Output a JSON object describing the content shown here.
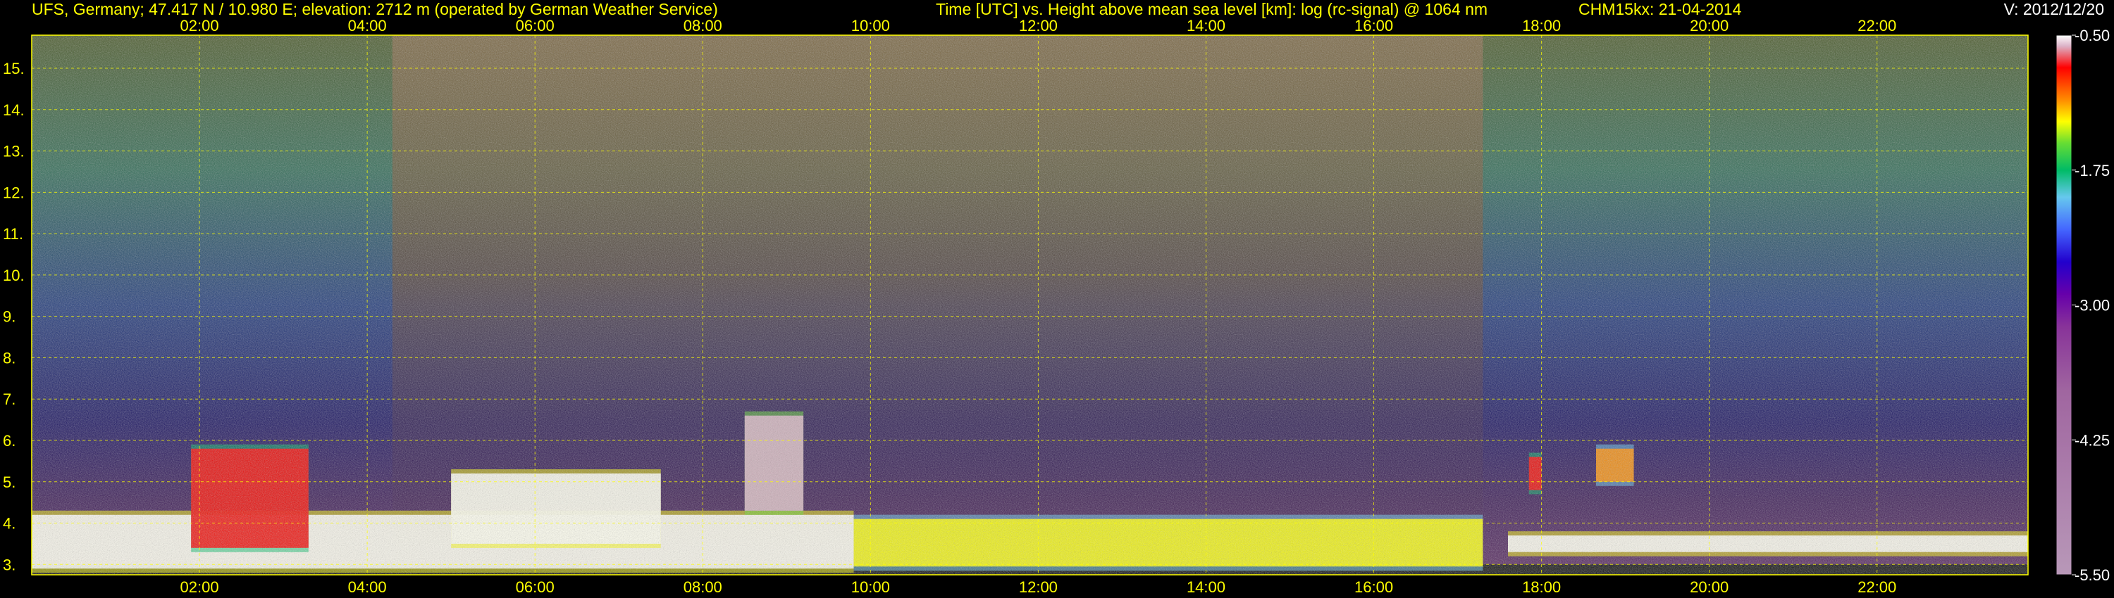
{
  "header": {
    "station": "UFS, Germany; 47.417 N / 10.980 E; elevation: 2712 m  (operated by German Weather Service)",
    "axes": "Time [UTC] vs. Height above mean sea level [km]: log (rc-signal) @ 1064 nm",
    "instrument": "CHM15kx: 21-04-2014",
    "version": "V: 2012/12/20"
  },
  "chart_data": {
    "type": "heatmap",
    "title": "Time [UTC] vs. Height above mean sea level [km]: log (rc-signal) @ 1064 nm",
    "x_unit": "hours UTC",
    "xlim": [
      0.0,
      23.8
    ],
    "x_ticks": [
      {
        "value": 2,
        "label": "02:00"
      },
      {
        "value": 4,
        "label": "04:00"
      },
      {
        "value": 6,
        "label": "06:00"
      },
      {
        "value": 8,
        "label": "08:00"
      },
      {
        "value": 10,
        "label": "10:00"
      },
      {
        "value": 12,
        "label": "12:00"
      },
      {
        "value": 14,
        "label": "14:00"
      },
      {
        "value": 16,
        "label": "16:00"
      },
      {
        "value": 18,
        "label": "18:00"
      },
      {
        "value": 20,
        "label": "20:00"
      },
      {
        "value": 22,
        "label": "22:00"
      }
    ],
    "y_unit": "km",
    "ylim": [
      2.75,
      15.8
    ],
    "y_ticks": [
      {
        "value": 3,
        "label": "3."
      },
      {
        "value": 4,
        "label": "4."
      },
      {
        "value": 5,
        "label": "5."
      },
      {
        "value": 6,
        "label": "6."
      },
      {
        "value": 7,
        "label": "7."
      },
      {
        "value": 8,
        "label": "8."
      },
      {
        "value": 9,
        "label": "9."
      },
      {
        "value": 10,
        "label": "10."
      },
      {
        "value": 11,
        "label": "11."
      },
      {
        "value": 12,
        "label": "12."
      },
      {
        "value": 13,
        "label": "13."
      },
      {
        "value": 14,
        "label": "14."
      },
      {
        "value": 15,
        "label": "15."
      }
    ],
    "grid": true,
    "colorbar": {
      "range": [
        -5.5,
        -0.5
      ],
      "ticks": [
        {
          "value": -0.5,
          "label": "-0.50"
        },
        {
          "value": -1.75,
          "label": "-1.75"
        },
        {
          "value": -3.0,
          "label": "-3.00"
        },
        {
          "value": -4.25,
          "label": "-4.25"
        },
        {
          "value": -5.5,
          "label": "-5.50"
        }
      ],
      "stops": [
        {
          "value": -0.5,
          "color": "#ffffff"
        },
        {
          "value": -0.6,
          "color": "#dcb4c8"
        },
        {
          "value": -0.8,
          "color": "#ff0000"
        },
        {
          "value": -1.1,
          "color": "#ff8c00"
        },
        {
          "value": -1.3,
          "color": "#ffff00"
        },
        {
          "value": -1.5,
          "color": "#66dd33"
        },
        {
          "value": -1.75,
          "color": "#00bb66"
        },
        {
          "value": -2.0,
          "color": "#66c8ee"
        },
        {
          "value": -2.3,
          "color": "#4466ff"
        },
        {
          "value": -2.6,
          "color": "#2200cc"
        },
        {
          "value": -2.9,
          "color": "#6600aa"
        },
        {
          "value": -3.2,
          "color": "#883399"
        },
        {
          "value": -3.8,
          "color": "#a066a0"
        },
        {
          "value": -5.5,
          "color": "#b898b8"
        }
      ]
    },
    "features": [
      {
        "kind": "boundary_layer",
        "t_start": 0.0,
        "t_end": 9.8,
        "z_bottom": 2.9,
        "z_top": 4.2,
        "log_signal": -0.55
      },
      {
        "kind": "aerosol_layer",
        "t_start": 1.9,
        "t_end": 3.3,
        "z_bottom": 3.4,
        "z_top": 5.8,
        "log_signal": -1.1
      },
      {
        "kind": "aerosol_layer",
        "t_start": 5.0,
        "t_end": 7.5,
        "z_bottom": 3.5,
        "z_top": 5.2,
        "log_signal": -0.6
      },
      {
        "kind": "elevated_plume",
        "t_start": 8.5,
        "t_end": 9.2,
        "z_bottom": 4.3,
        "z_top": 6.6,
        "log_signal": -0.8
      },
      {
        "kind": "boundary_layer",
        "t_start": 9.8,
        "t_end": 17.3,
        "z_bottom": 2.95,
        "z_top": 4.1,
        "log_signal": -1.4
      },
      {
        "kind": "cloud",
        "t_start": 17.85,
        "t_end": 18.0,
        "z_bottom": 4.8,
        "z_top": 5.6,
        "log_signal": -0.9
      },
      {
        "kind": "cloud",
        "t_start": 18.65,
        "t_end": 19.1,
        "z_bottom": 5.0,
        "z_top": 5.8,
        "log_signal": -1.2
      },
      {
        "kind": "residual_layer",
        "t_start": 17.6,
        "t_end": 23.8,
        "z_bottom": 3.3,
        "z_top": 3.7,
        "log_signal": -0.6
      }
    ]
  }
}
